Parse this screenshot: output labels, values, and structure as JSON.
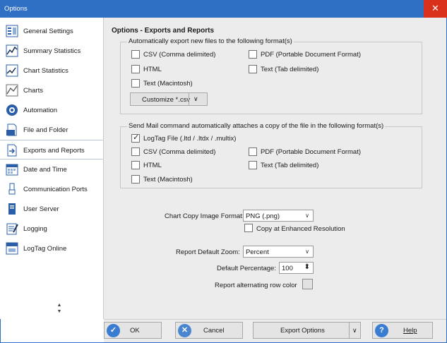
{
  "window": {
    "title": "Options",
    "close_glyph": "✕"
  },
  "sidebar": {
    "items": [
      {
        "label": "General Settings",
        "icon": "settings-icon"
      },
      {
        "label": "Summary Statistics",
        "icon": "summary-statistics-icon"
      },
      {
        "label": "Chart Statistics",
        "icon": "chart-statistics-icon"
      },
      {
        "label": "Charts",
        "icon": "charts-icon"
      },
      {
        "label": "Automation",
        "icon": "automation-icon"
      },
      {
        "label": "File and Folder",
        "icon": "file-folder-icon"
      },
      {
        "label": "Exports and Reports",
        "icon": "exports-reports-icon",
        "selected": true
      },
      {
        "label": "Date and Time",
        "icon": "calendar-icon"
      },
      {
        "label": "Communication Ports",
        "icon": "usb-icon"
      },
      {
        "label": "User Server",
        "icon": "server-icon"
      },
      {
        "label": "Logging",
        "icon": "logging-icon"
      },
      {
        "label": "LogTag Online",
        "icon": "logtag-online-icon"
      }
    ],
    "scroll_up": "▲",
    "scroll_down": "▼"
  },
  "main": {
    "title": "Options - Exports and Reports",
    "auto_export": {
      "legend": "Automatically export new files to the following format(s)",
      "options": [
        {
          "label": "CSV (Comma delimited)",
          "checked": false
        },
        {
          "label": "PDF (Portable Document Format)",
          "checked": false
        },
        {
          "label": "HTML",
          "checked": false
        },
        {
          "label": "Text (Tab delimited)",
          "checked": false
        },
        {
          "label": "Text (Macintosh)",
          "checked": false
        }
      ],
      "customize_label": "Customize *.csv",
      "customize_arrow": "∨"
    },
    "send_mail": {
      "legend": "Send Mail command automatically attaches a copy of the file in the following format(s)",
      "options": [
        {
          "label": "LogTag File (.ltd / .ltdx / .multix)",
          "checked": true
        },
        {
          "label": "CSV (Comma delimited)",
          "checked": false
        },
        {
          "label": "PDF (Portable Document Format)",
          "checked": false
        },
        {
          "label": "HTML",
          "checked": false
        },
        {
          "label": "Text (Tab delimited)",
          "checked": false
        },
        {
          "label": "Text (Macintosh)",
          "checked": false
        }
      ]
    },
    "chart_copy": {
      "label": "Chart Copy Image Format:",
      "value": "PNG (.png)",
      "arrow": "∨",
      "enhanced_label": "Copy at Enhanced Resolution",
      "enhanced_checked": false
    },
    "report": {
      "zoom_label": "Report Default Zoom:",
      "zoom_value": "Percent",
      "zoom_arrow": "∨",
      "percentage_label": "Default Percentage:",
      "percentage_value": "100",
      "spin_glyph": "⬍",
      "alt_row_label": "Report alternating row color",
      "alt_row_color": "#e2e2e2"
    }
  },
  "footer": {
    "ok_label": "OK",
    "ok_glyph": "✓",
    "cancel_label": "Cancel",
    "cancel_glyph": "✕",
    "export_label": "Export Options",
    "export_arrow": "∨",
    "help_label": "Help",
    "help_glyph": "?"
  },
  "colors": {
    "title_bar": "#2f6fc4",
    "close": "#d9301c",
    "ok": "#3a7cd1",
    "cancel": "#4a86cf",
    "help": "#3a7cd1"
  }
}
